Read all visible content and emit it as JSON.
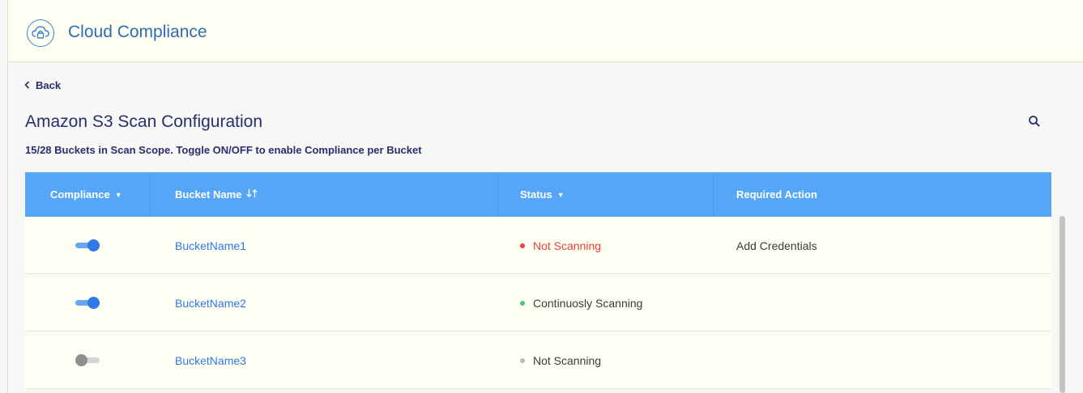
{
  "app": {
    "title": "Cloud Compliance",
    "icon": "cloud-lock-icon"
  },
  "nav": {
    "back_label": "Back"
  },
  "page": {
    "title": "Amazon S3 Scan Configuration",
    "subtitle": "15/28 Buckets in Scan Scope. Toggle ON/OFF to enable Compliance per Bucket"
  },
  "table": {
    "headers": {
      "compliance": "Compliance",
      "bucket_name": "Bucket Name",
      "status": "Status",
      "required_action": "Required Action"
    },
    "rows": [
      {
        "compliance_on": true,
        "bucket": "BucketName1",
        "status": "Not Scanning",
        "status_color": "#e8413a",
        "status_text_color": "#e8413a",
        "action": "Add Credentials"
      },
      {
        "compliance_on": true,
        "bucket": "BucketName2",
        "status": "Continuosly Scanning",
        "status_color": "#4ec27a",
        "status_text_color": "#3b3b3b",
        "action": ""
      },
      {
        "compliance_on": false,
        "bucket": "BucketName3",
        "status": "Not Scanning",
        "status_color": "#b8b8b8",
        "status_text_color": "#3b3b3b",
        "action": ""
      }
    ]
  },
  "colors": {
    "accent": "#55a6f6",
    "title_text": "#2a2e6f",
    "link": "#2f78e6",
    "header_bg": "#fffef2"
  }
}
